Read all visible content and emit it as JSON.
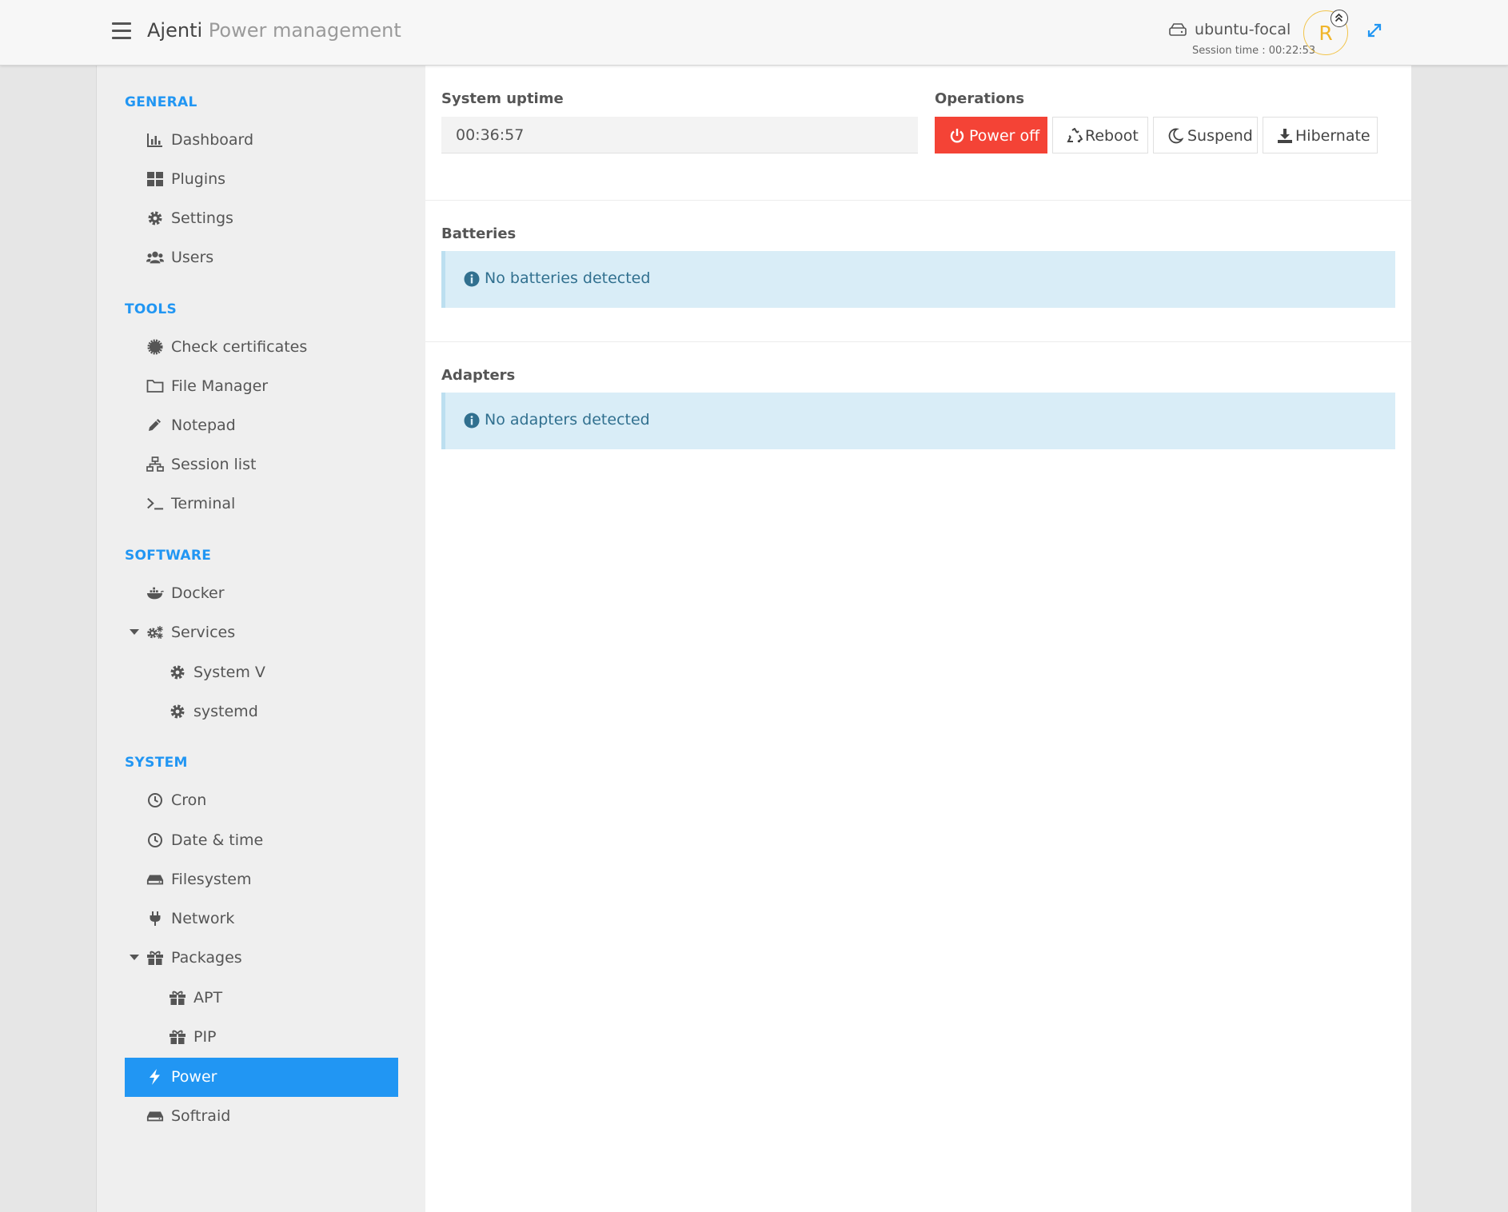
{
  "header": {
    "app_name": "Ajenti",
    "page_title": "Power management",
    "hostname": "ubuntu-focal",
    "session_time": "Session time : 00:22:53",
    "avatar_initial": "R"
  },
  "sidebar": {
    "sections": {
      "general": "GENERAL",
      "tools": "TOOLS",
      "software": "SOFTWARE",
      "system": "SYSTEM"
    },
    "items": {
      "dashboard": "Dashboard",
      "plugins": "Plugins",
      "settings": "Settings",
      "users": "Users",
      "check_certificates": "Check certificates",
      "file_manager": "File Manager",
      "notepad": "Notepad",
      "session_list": "Session list",
      "terminal": "Terminal",
      "docker": "Docker",
      "services": "Services",
      "system_v": "System V",
      "systemd": "systemd",
      "cron": "Cron",
      "date_time": "Date & time",
      "filesystem": "Filesystem",
      "network": "Network",
      "packages": "Packages",
      "apt": "APT",
      "pip": "PIP",
      "power": "Power",
      "softraid": "Softraid"
    },
    "active_item": "Power"
  },
  "main": {
    "uptime_label": "System uptime",
    "uptime_value": "00:36:57",
    "operations_label": "Operations",
    "buttons": {
      "power_off": "Power off",
      "reboot": "Reboot",
      "suspend": "Suspend",
      "hibernate": "Hibernate"
    },
    "batteries_label": "Batteries",
    "batteries_message": "No batteries detected",
    "adapters_label": "Adapters",
    "adapters_message": "No adapters detected"
  },
  "colors": {
    "accent": "#2196f3",
    "danger": "#f44336",
    "info_bg": "#d9edf7",
    "info_text": "#31708f",
    "avatar": "#f0b52a"
  },
  "icons": {
    "menu": "hamburger-icon",
    "host": "hdd-icon",
    "expand": "expand-icon",
    "info": "info-circle-icon"
  }
}
